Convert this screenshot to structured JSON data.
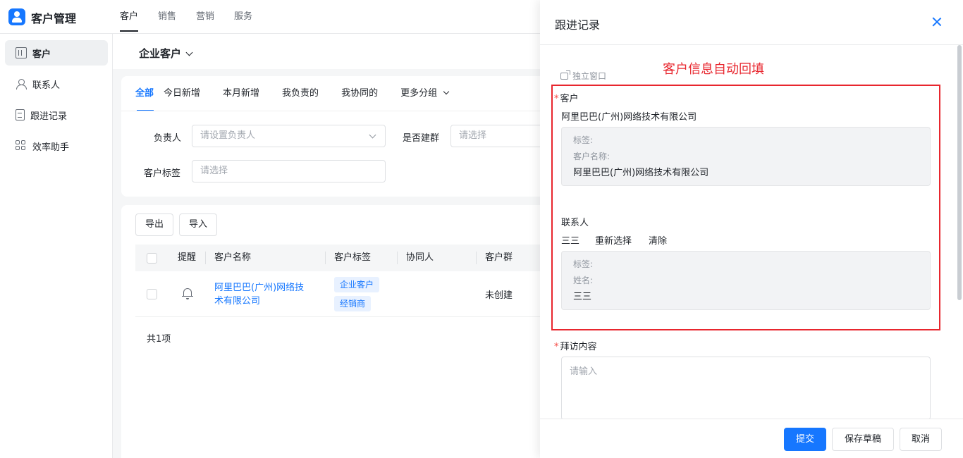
{
  "app": {
    "title": "客户管理"
  },
  "top_nav": {
    "tabs": [
      {
        "label": "客户"
      },
      {
        "label": "销售"
      },
      {
        "label": "营销"
      },
      {
        "label": "服务"
      }
    ]
  },
  "sidebar": {
    "items": [
      {
        "label": "客户",
        "icon": "building-icon"
      },
      {
        "label": "联系人",
        "icon": "contact-icon"
      },
      {
        "label": "跟进记录",
        "icon": "record-icon"
      },
      {
        "label": "效率助手",
        "icon": "apps-icon"
      }
    ]
  },
  "main": {
    "page_title": "企业客户",
    "filter_tabs": [
      {
        "label": "全部"
      },
      {
        "label": "今日新增"
      },
      {
        "label": "本月新增"
      },
      {
        "label": "我负责的"
      },
      {
        "label": "我协同的"
      },
      {
        "label": "更多分组"
      }
    ],
    "filters": {
      "owner_label": "负责人",
      "owner_placeholder": "请设置负责人",
      "group_label": "是否建群",
      "group_placeholder": "请选择",
      "tag_label": "客户标签",
      "tag_placeholder": "请选择"
    },
    "actions": {
      "export": "导出",
      "import": "导入"
    },
    "table": {
      "headers": {
        "remind": "提醒",
        "name": "客户名称",
        "tags": "客户标签",
        "collaborator": "协同人",
        "group": "客户群"
      },
      "rows": [
        {
          "name_line1": "阿里巴巴(广州)网络技",
          "name_line2": "术有限公司",
          "tags": [
            "企业客户",
            "经销商"
          ],
          "group": "未创建"
        }
      ]
    },
    "total": "共1项"
  },
  "drawer": {
    "title": "跟进记录",
    "popout": "独立窗口",
    "annotation": "客户信息自动回填",
    "customer": {
      "label": "客户",
      "value": "阿里巴巴(广州)网络技术有限公司",
      "tag_label": "标签:",
      "name_label": "客户名称:",
      "name_value": "阿里巴巴(广州)网络技术有限公司"
    },
    "contact": {
      "label": "联系人",
      "value": "三三",
      "reselect": "重新选择",
      "clear": "清除",
      "tag_label": "标签:",
      "name_label": "姓名:",
      "name_value": "三三"
    },
    "visit": {
      "label": "拜访内容",
      "placeholder": "请输入"
    },
    "footer": {
      "submit": "提交",
      "save_draft": "保存草稿",
      "cancel": "取消"
    }
  },
  "colors": {
    "accent": "#1677ff",
    "annotation": "#e8262e",
    "required": "#f54a45"
  }
}
